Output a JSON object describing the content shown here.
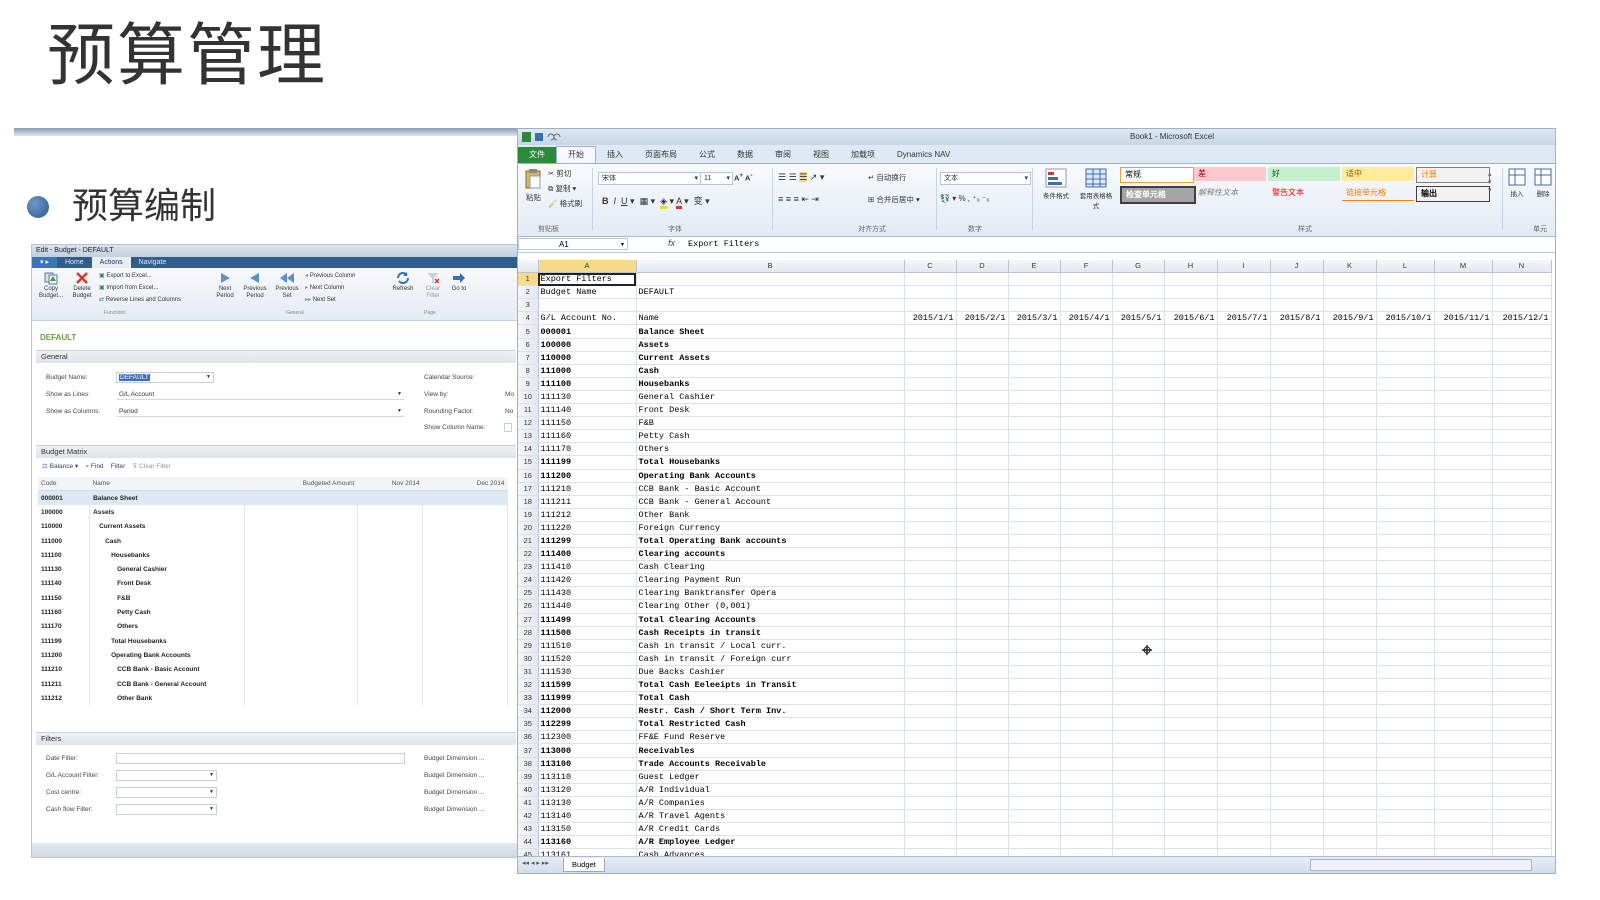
{
  "slide": {
    "title": "预算管理",
    "subtitle": "预算编制"
  },
  "nav": {
    "window_title": "Edit - Budget - DEFAULT",
    "tabs": [
      "Home",
      "Actions",
      "Navigate"
    ],
    "ribbon": {
      "copy_budget": "Copy Budget...",
      "delete_budget": "Delete Budget",
      "export_excel": "Export to Excel...",
      "import_excel": "Import from Excel...",
      "reverse_lines": "Reverse Lines and Columns",
      "group_functions": "Functions",
      "next_period": "Next Period",
      "previous_period": "Previous Period",
      "previous_set": "Previous Set",
      "previous_column": "Previous Column",
      "next_column": "Next Column",
      "next_set": "Next Set",
      "group_general": "General",
      "refresh": "Refresh",
      "clear_filter": "Clear Filter",
      "go_to": "Go to",
      "group_page": "Page"
    },
    "company": "DEFAULT",
    "general": {
      "header": "General",
      "budget_name_label": "Budget Name:",
      "budget_name_value": "DEFAULT",
      "show_lines_label": "Show as Lines:",
      "show_lines_value": "G/L Account",
      "show_columns_label": "Show as Columns:",
      "show_columns_value": "Period",
      "calendar_source_label": "Calendar Source:",
      "view_by_label": "View by:",
      "view_by_value": "Mo",
      "rounding_label": "Rounding Factor:",
      "rounding_value": "No",
      "show_col_name_label": "Show Column Name:"
    },
    "matrix": {
      "header": "Budget Matrix",
      "toolbar": {
        "balance": "Balance",
        "find": "Find",
        "filter": "Filter",
        "clear_filter": "Clear Filter"
      },
      "columns": [
        "Code",
        "Name",
        "Budgeted Amount",
        "Nov 2014",
        "Dec 2014"
      ],
      "rows": [
        {
          "code": "000001",
          "name": "Balance Sheet",
          "indent": 0
        },
        {
          "code": "100000",
          "name": "Assets",
          "indent": 0
        },
        {
          "code": "110000",
          "name": "Current Assets",
          "indent": 1
        },
        {
          "code": "111000",
          "name": "Cash",
          "indent": 2
        },
        {
          "code": "111100",
          "name": "Housebanks",
          "indent": 3
        },
        {
          "code": "111130",
          "name": "General Cashier",
          "indent": 4
        },
        {
          "code": "111140",
          "name": "Front Desk",
          "indent": 4
        },
        {
          "code": "111150",
          "name": "F&B",
          "indent": 4
        },
        {
          "code": "111160",
          "name": "Petty Cash",
          "indent": 4
        },
        {
          "code": "111170",
          "name": "Others",
          "indent": 4
        },
        {
          "code": "111199",
          "name": "Total Housebanks",
          "indent": 3
        },
        {
          "code": "111200",
          "name": "Operating Bank Accounts",
          "indent": 3
        },
        {
          "code": "111210",
          "name": "CCB Bank - Basic Account",
          "indent": 4
        },
        {
          "code": "111211",
          "name": "CCB Bank - General Account",
          "indent": 4
        },
        {
          "code": "111212",
          "name": "Other Bank",
          "indent": 4
        }
      ]
    },
    "filters": {
      "header": "Filters",
      "date_filter": "Date Filter:",
      "gl_account_filter": "G/L Account Filter:",
      "cost_centre": "Cost centre:",
      "cash_flow_filter": "Cash flow Filter:",
      "budget_dimension": "Budget Dimension ..."
    }
  },
  "excel": {
    "window_title": "Book1 - Microsoft Excel",
    "tabs": [
      "文件",
      "开始",
      "插入",
      "页面布局",
      "公式",
      "数据",
      "审阅",
      "视图",
      "加载项",
      "Dynamics NAV"
    ],
    "ribbon": {
      "paste": "粘贴",
      "cut": "剪切",
      "copy": "复制",
      "format_painter": "格式刷",
      "font_name": "宋体",
      "font_size": "11",
      "wrap_text": "自动换行",
      "merge_center": "合并后居中",
      "number_format": "文本",
      "cond_format": "条件格式",
      "table_format": "套用表格格式",
      "group_clipboard": "剪贴板",
      "group_font": "字体",
      "group_align": "对齐方式",
      "group_number": "数字",
      "group_styles": "样式",
      "group_cells": "单元",
      "insert": "插入",
      "delete": "删除",
      "style_normal": "常规",
      "style_bad": "差",
      "style_good": "好",
      "style_neutral": "适中",
      "style_calc": "计算",
      "style_check": "检查单元格",
      "style_explain": "解释性文本",
      "style_warning": "警告文本",
      "style_linked": "链接单元格",
      "style_output": "输出"
    },
    "name_box": "A1",
    "formula": "Export Filters",
    "columns": [
      "A",
      "B",
      "C",
      "D",
      "E",
      "F",
      "G",
      "H",
      "I",
      "J",
      "K",
      "L",
      "M",
      "N"
    ],
    "dates": [
      "2015/1/1",
      "2015/2/1",
      "2015/3/1",
      "2015/4/1",
      "2015/5/1",
      "2015/6/1",
      "2015/7/1",
      "2015/8/1",
      "2015/9/1",
      "2015/10/1",
      "2015/11/1",
      "2015/12/1"
    ],
    "rows": [
      {
        "n": "1",
        "a": "Export Filters",
        "b": "",
        "bold": false
      },
      {
        "n": "2",
        "a": "Budget Name",
        "b": "DEFAULT",
        "bold": false
      },
      {
        "n": "3",
        "a": "",
        "b": "",
        "bold": false
      },
      {
        "n": "4",
        "a": "G/L Account No.",
        "b": "Name",
        "bold": false
      },
      {
        "n": "5",
        "a": "000001",
        "b": "Balance Sheet",
        "bold": true
      },
      {
        "n": "6",
        "a": "100000",
        "b": "Assets",
        "bold": true
      },
      {
        "n": "7",
        "a": "110000",
        "b": "Current Assets",
        "bold": true
      },
      {
        "n": "8",
        "a": "111000",
        "b": "Cash",
        "bold": true
      },
      {
        "n": "9",
        "a": "111100",
        "b": "Housebanks",
        "bold": true
      },
      {
        "n": "10",
        "a": "111130",
        "b": "General Cashier",
        "bold": false
      },
      {
        "n": "11",
        "a": "111140",
        "b": "Front Desk",
        "bold": false
      },
      {
        "n": "12",
        "a": "111150",
        "b": "F&B",
        "bold": false
      },
      {
        "n": "13",
        "a": "111160",
        "b": "Petty Cash",
        "bold": false
      },
      {
        "n": "14",
        "a": "111170",
        "b": "Others",
        "bold": false
      },
      {
        "n": "15",
        "a": "111199",
        "b": "Total Housebanks",
        "bold": true
      },
      {
        "n": "16",
        "a": "111200",
        "b": "Operating Bank Accounts",
        "bold": true
      },
      {
        "n": "17",
        "a": "111210",
        "b": "CCB Bank - Basic Account",
        "bold": false
      },
      {
        "n": "18",
        "a": "111211",
        "b": "CCB Bank - General Account",
        "bold": false
      },
      {
        "n": "19",
        "a": "111212",
        "b": "Other Bank",
        "bold": false
      },
      {
        "n": "20",
        "a": "111220",
        "b": "Foreign Currency",
        "bold": false
      },
      {
        "n": "21",
        "a": "111299",
        "b": "Total Operating Bank accounts",
        "bold": true
      },
      {
        "n": "22",
        "a": "111400",
        "b": "Clearing accounts",
        "bold": true
      },
      {
        "n": "23",
        "a": "111410",
        "b": "Cash Clearing",
        "bold": false
      },
      {
        "n": "24",
        "a": "111420",
        "b": "Clearing Payment Run",
        "bold": false
      },
      {
        "n": "25",
        "a": "111430",
        "b": "Clearing Banktransfer Opera",
        "bold": false
      },
      {
        "n": "26",
        "a": "111440",
        "b": "Clearing Other (0,001)",
        "bold": false
      },
      {
        "n": "27",
        "a": "111499",
        "b": "Total Clearing Accounts",
        "bold": true
      },
      {
        "n": "28",
        "a": "111500",
        "b": "Cash Receipts in transit",
        "bold": true
      },
      {
        "n": "29",
        "a": "111510",
        "b": "Cash in transit / Local curr.",
        "bold": false
      },
      {
        "n": "30",
        "a": "111520",
        "b": "Cash in transit / Foreign curr",
        "bold": false
      },
      {
        "n": "31",
        "a": "111530",
        "b": "Due Backs Cashier",
        "bold": false
      },
      {
        "n": "32",
        "a": "111599",
        "b": "Total Cash Eeleeipts in Transit",
        "bold": true
      },
      {
        "n": "33",
        "a": "111999",
        "b": "Total Cash",
        "bold": true
      },
      {
        "n": "34",
        "a": "112000",
        "b": "Restr. Cash / Short Term Inv.",
        "bold": true
      },
      {
        "n": "35",
        "a": "112299",
        "b": "Total Restricted Cash",
        "bold": true
      },
      {
        "n": "36",
        "a": "112300",
        "b": "FF&E Fund Reserve",
        "bold": false
      },
      {
        "n": "37",
        "a": "113000",
        "b": "Receivables",
        "bold": true
      },
      {
        "n": "38",
        "a": "113100",
        "b": "Trade Accounts Receivable",
        "bold": true
      },
      {
        "n": "39",
        "a": "113110",
        "b": "Guest Ledger",
        "bold": false
      },
      {
        "n": "40",
        "a": "113120",
        "b": "A/R Individual",
        "bold": false
      },
      {
        "n": "41",
        "a": "113130",
        "b": "A/R Companies",
        "bold": false
      },
      {
        "n": "42",
        "a": "113140",
        "b": "A/R Travel Agents",
        "bold": false
      },
      {
        "n": "43",
        "a": "113150",
        "b": "A/R Credit Cards",
        "bold": false
      },
      {
        "n": "44",
        "a": "113160",
        "b": "A/R Employee Ledger",
        "bold": true
      },
      {
        "n": "45",
        "a": "113161",
        "b": "Cash Advances",
        "bold": false
      }
    ],
    "sheet_tab": "Budget"
  },
  "colors": {
    "excel_file_tab": "#2a8a3a",
    "nav_ribbon": "#2f5d8f",
    "selected_header": "#f7d98a",
    "company_green": "#6aa03a"
  }
}
